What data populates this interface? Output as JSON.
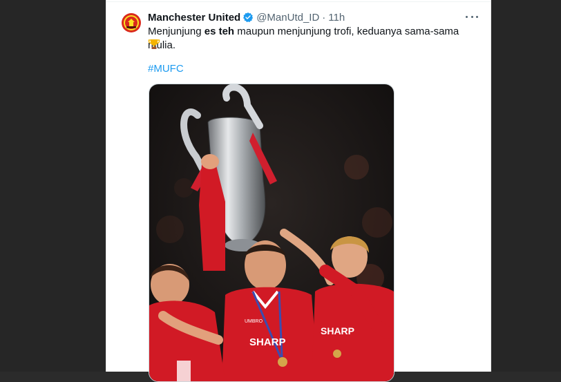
{
  "tweet": {
    "author_name": "Manchester United",
    "handle": "@ManUtd_ID",
    "separator": "·",
    "time": "11h",
    "text_before": "Menjunjung ",
    "text_bold": "es teh",
    "text_after": " maupun menjunjung trofi, keduanya sama-sama mulia.",
    "hashtag": "#MUFC",
    "emoji": "trophy",
    "verified_color": "#1d9bf0",
    "media": {
      "shirt_text": "SHARP",
      "shirt_sleeve_text": "UMBRO"
    }
  },
  "icons": {
    "avatar": "manchester-united-crest",
    "verified": "verified-badge-icon",
    "more": "more-options-icon"
  },
  "colors": {
    "link": "#1d9bf0",
    "text": "#0f1419",
    "secondary": "#536471",
    "kit_red": "#c8102e"
  }
}
